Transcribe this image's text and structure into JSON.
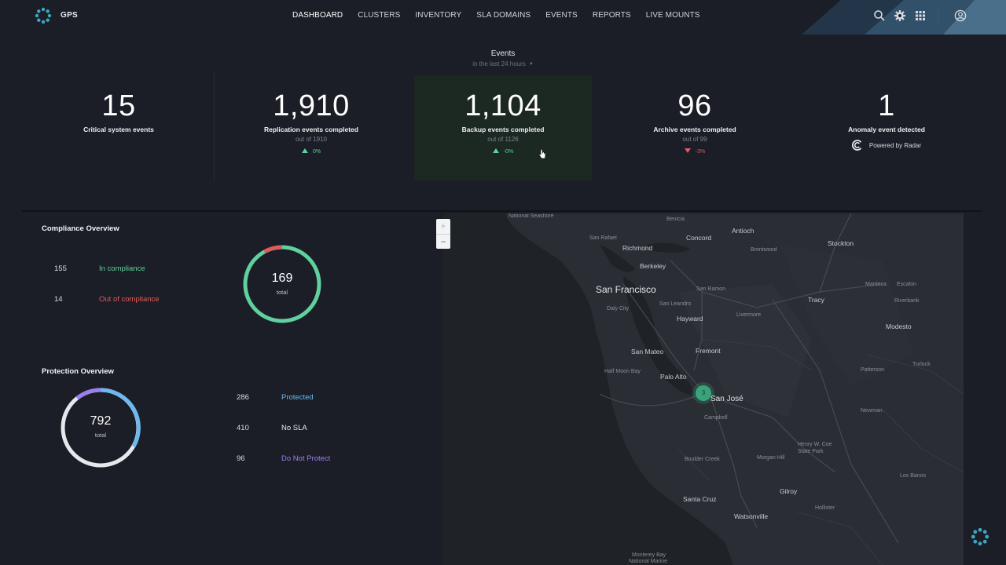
{
  "app": {
    "title": "GPS"
  },
  "nav": {
    "items": [
      {
        "label": "DASHBOARD",
        "active": true
      },
      {
        "label": "CLUSTERS",
        "active": false
      },
      {
        "label": "INVENTORY",
        "active": false
      },
      {
        "label": "SLA DOMAINS",
        "active": false
      },
      {
        "label": "EVENTS",
        "active": false
      },
      {
        "label": "REPORTS",
        "active": false
      },
      {
        "label": "LIVE MOUNTS",
        "active": false
      }
    ],
    "icons": [
      "search-icon",
      "gear-icon",
      "apps-grid-icon",
      "user-account-icon"
    ]
  },
  "events": {
    "title": "Events",
    "range": "in the last 24 hours",
    "stats": [
      {
        "value": "15",
        "label": "Critical system events",
        "sub": "",
        "delta": ""
      },
      {
        "value": "1,910",
        "label": "Replication events completed",
        "sub": "out of 1910",
        "delta": "0%",
        "direction": "up"
      },
      {
        "value": "1,104",
        "label": "Backup events completed",
        "sub": "out of 1126",
        "delta": "-0%",
        "direction": "up"
      },
      {
        "value": "96",
        "label": "Archive events completed",
        "sub": "out of 99",
        "delta": "-3%",
        "direction": "down"
      },
      {
        "value": "1",
        "label": "Anomaly event detected",
        "sub": "",
        "powered_by": "Powered by Radar"
      }
    ]
  },
  "compliance": {
    "title": "Compliance Overview",
    "rows": [
      {
        "count": "155",
        "label": "In compliance",
        "color": "#5fd09e"
      },
      {
        "count": "14",
        "label": "Out of compliance",
        "color": "#e05b5b"
      }
    ],
    "total": "169",
    "total_label": "total",
    "fraction_in_compliance": 0.917
  },
  "protection": {
    "title": "Protection Overview",
    "rows": [
      {
        "count": "286",
        "label": "Protected",
        "color": "#6cb8f0"
      },
      {
        "count": "410",
        "label": "No SLA",
        "color": "#e6e8ec"
      },
      {
        "count": "96",
        "label": "Do Not Protect",
        "color": "#9b7ff0"
      }
    ],
    "total": "792",
    "total_label": "total"
  },
  "map": {
    "zoom_in": "+",
    "zoom_out": "−",
    "cluster_count": "3",
    "labels": {
      "national_seashore": "National Seashore",
      "benicia": "Benicia",
      "antioch": "Antioch",
      "concord": "Concord",
      "stockton": "Stockton",
      "san_rafael": "San Rafael",
      "richmond": "Richmond",
      "brentwood": "Brentwood",
      "berkeley": "Berkeley",
      "manteca": "Manteca",
      "san_francisco": "San Francisco",
      "san_ramon": "San Ramon",
      "escalon": "Escalon",
      "san_leandro": "San Leandro",
      "daly_city": "Daly City",
      "tracy": "Tracy",
      "riverbank": "Riverbank",
      "hayward": "Hayward",
      "livermore": "Livermore",
      "modesto": "Modesto",
      "san_mateo": "San Mateo",
      "fremont": "Fremont",
      "patterson": "Patterson",
      "turlock": "Turlock",
      "half_moon_bay": "Half Moon Bay",
      "palo_alto": "Palo Alto",
      "san_jose": "San José",
      "campbell": "Campbell",
      "newman": "Newman",
      "henry_coe": "Henry W. Coe State Park",
      "boulder_creek": "Boulder Creek",
      "morgan_hill": "Morgan Hill",
      "los_banos": "Los Banos",
      "gilroy": "Gilroy",
      "santa_cruz": "Santa Cruz",
      "watsonville": "Watsonville",
      "hollister": "Hollister",
      "monterey_bay": "Monterey Bay",
      "national_marine": "National Marine"
    }
  }
}
